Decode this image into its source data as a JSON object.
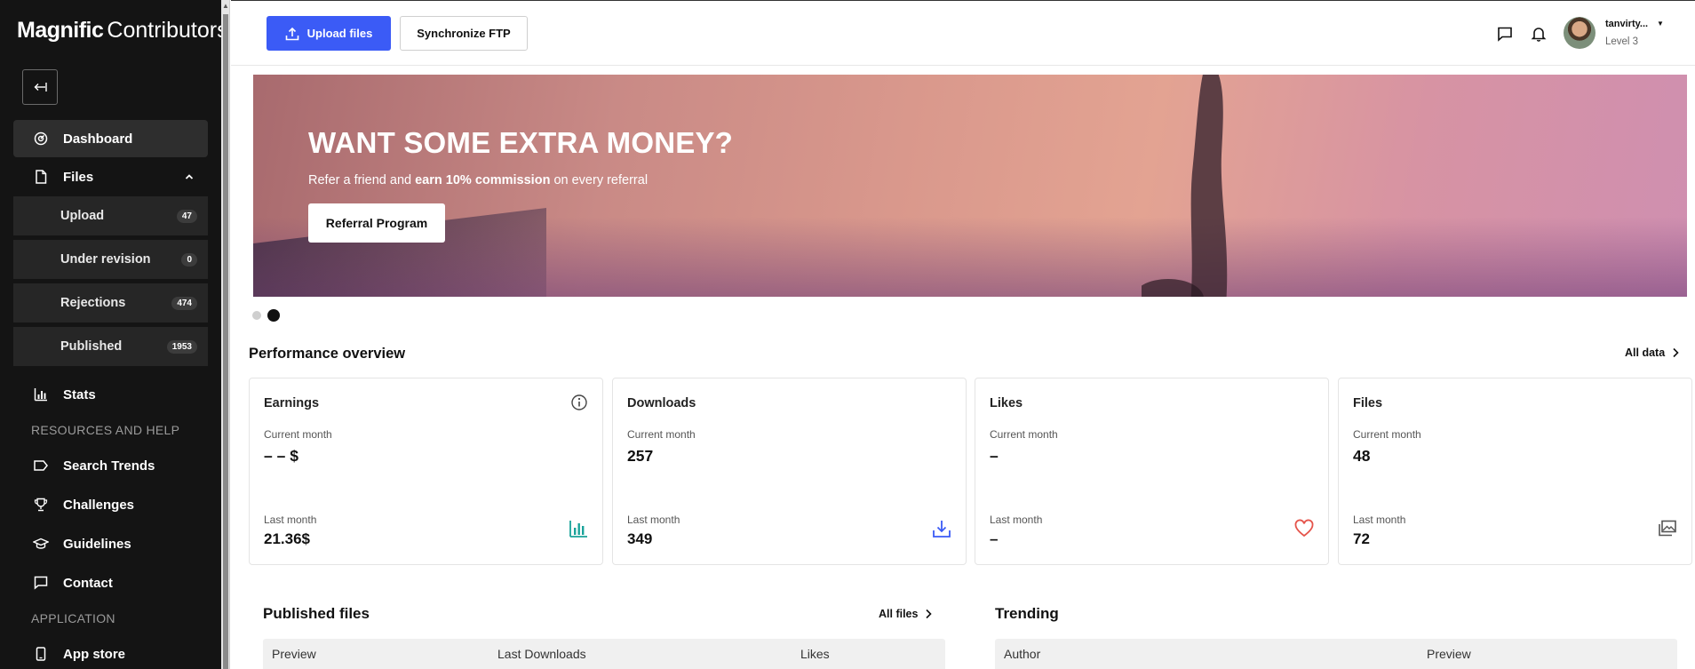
{
  "brand": {
    "name": "Magnific",
    "suffix": "Contributors"
  },
  "sidebar": {
    "dashboard": "Dashboard",
    "files": "Files",
    "sub_items": [
      {
        "label": "Upload",
        "count": "47"
      },
      {
        "label": "Under revision",
        "count": "0"
      },
      {
        "label": "Rejections",
        "count": "474"
      },
      {
        "label": "Published",
        "count": "1953"
      }
    ],
    "stats": "Stats",
    "section_resources": "RESOURCES AND HELP",
    "search_trends": "Search Trends",
    "challenges": "Challenges",
    "guidelines": "Guidelines",
    "contact": "Contact",
    "section_application": "APPLICATION",
    "app_store": "App store"
  },
  "topbar": {
    "upload_label": "Upload files",
    "ftp_label": "Synchronize FTP",
    "user_name": "tanvirty...",
    "user_level": "Level 3"
  },
  "banner": {
    "title": "WANT SOME EXTRA MONEY?",
    "subtitle_pre": "Refer a friend and ",
    "subtitle_bold": "earn 10% commission",
    "subtitle_post": " on every referral",
    "button": "Referral Program",
    "active_slide": 2,
    "slide_count": 2
  },
  "performance": {
    "title": "Performance overview",
    "all_data": "All data",
    "cards": [
      {
        "title": "Earnings",
        "current_label": "Current month",
        "current_value": "– – $",
        "last_label": "Last month",
        "last_value": "21.36$",
        "icon": "bar-chart-icon",
        "color": "#1aa39a"
      },
      {
        "title": "Downloads",
        "current_label": "Current month",
        "current_value": "257",
        "last_label": "Last month",
        "last_value": "349",
        "icon": "download-icon",
        "color": "#3b5bf6"
      },
      {
        "title": "Likes",
        "current_label": "Current month",
        "current_value": "–",
        "last_label": "Last month",
        "last_value": "–",
        "icon": "heart-icon",
        "color": "#e5544b"
      },
      {
        "title": "Files",
        "current_label": "Current month",
        "current_value": "48",
        "last_label": "Last month",
        "last_value": "72",
        "icon": "images-icon",
        "color": "#555555"
      }
    ]
  },
  "published": {
    "title": "Published files",
    "all_files": "All files",
    "columns": [
      "Preview",
      "Last Downloads",
      "Likes"
    ]
  },
  "trending": {
    "title": "Trending",
    "columns": [
      "Author",
      "Preview"
    ]
  },
  "colors": {
    "accent": "#3b5bf6",
    "sidebar_bg": "#141414"
  }
}
